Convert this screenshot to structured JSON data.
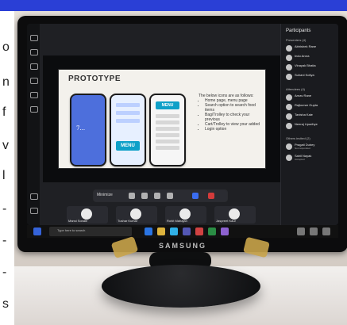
{
  "header": {
    "bar_color": "#2a3fd6"
  },
  "left_text_fragments": [
    "o",
    "n",
    "f",
    "v",
    "l",
    "-",
    "-",
    "-",
    "s"
  ],
  "monitor": {
    "brand": "SAMSUNG"
  },
  "meeting": {
    "slide": {
      "title": "PROTOTYPE",
      "phone_titles": {
        "phone1": "7...",
        "phone2_menu_button": "MENU",
        "phone3_menu_header": "MENU"
      },
      "bullets": [
        "The below icons are as follows:",
        "Home page, menu page",
        "Search option to search food items",
        "Bag/Trolley to check your previous",
        "Cart/Trolley to view your added",
        "Login option"
      ]
    },
    "call_controls": {
      "label": "Minimize",
      "buttons": [
        "camera",
        "mic",
        "share",
        "more",
        "leave",
        "end"
      ]
    },
    "tiles": [
      {
        "label": "Mansi Sonale"
      },
      {
        "label": "Tushar Kumar"
      },
      {
        "label": "Rohit Mahajan"
      },
      {
        "label": "Jaspreet Kaur"
      }
    ],
    "participants_panel": {
      "title": "Participants",
      "sections": [
        {
          "label": "Presenters (4)"
        },
        {
          "label": "Attendees (4)"
        },
        {
          "label": "Others invited (2)"
        }
      ],
      "presenters": [
        {
          "name": "Abhishek Rane",
          "sub": ""
        },
        {
          "name": "Indu Arora",
          "sub": ""
        },
        {
          "name": "Vinayak Bhatia",
          "sub": ""
        },
        {
          "name": "Suhani Kotiya",
          "sub": ""
        }
      ],
      "attendees": [
        {
          "name": "Arnav Rane",
          "sub": ""
        },
        {
          "name": "Rajkumar Gupta",
          "sub": ""
        },
        {
          "name": "Tanisha Kale",
          "sub": ""
        },
        {
          "name": "Neeraj Upadhye",
          "sub": ""
        }
      ],
      "others": [
        {
          "name": "Pragati Dubey",
          "sub": "Not responded"
        },
        {
          "name": "Sahil Nayak",
          "sub": "Accepted"
        }
      ]
    }
  },
  "taskbar": {
    "search_placeholder": "Type here to search"
  },
  "stickers": [
    "sticker-left",
    "sticker-right"
  ],
  "colors": {
    "accent": "#2a3fd6",
    "end_call": "#d33b3b",
    "share": "#3a6df0",
    "menu": "#0fa0c8",
    "stickers": "#c9a44a"
  }
}
